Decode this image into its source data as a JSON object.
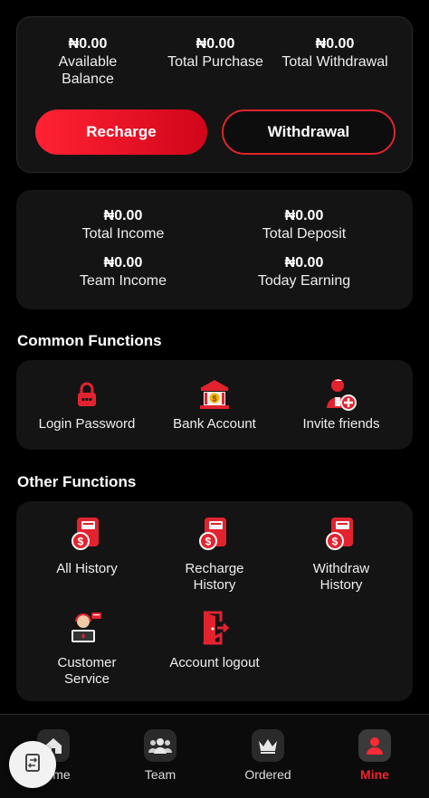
{
  "balance": {
    "stats": [
      {
        "amount": "₦0.00",
        "label": "Available Balance"
      },
      {
        "amount": "₦0.00",
        "label": "Total Purchase"
      },
      {
        "amount": "₦0.00",
        "label": "Total Withdrawal"
      }
    ],
    "recharge_label": "Recharge",
    "withdrawal_label": "Withdrawal"
  },
  "income": {
    "stats": [
      {
        "amount": "₦0.00",
        "label": "Total Income"
      },
      {
        "amount": "₦0.00",
        "label": "Total Deposit"
      },
      {
        "amount": "₦0.00",
        "label": "Team Income"
      },
      {
        "amount": "₦0.00",
        "label": "Today Earning"
      }
    ]
  },
  "common_functions": {
    "title": "Common Functions",
    "items": [
      {
        "label": "Login Password",
        "icon": "lock-icon"
      },
      {
        "label": "Bank Account",
        "icon": "bank-icon"
      },
      {
        "label": "Invite friends",
        "icon": "add-user-icon"
      }
    ]
  },
  "other_functions": {
    "title": "Other Functions",
    "items": [
      {
        "label": "All History",
        "icon": "dollar-document-icon"
      },
      {
        "label": "Recharge History",
        "icon": "dollar-document-icon"
      },
      {
        "label": "Withdraw History",
        "icon": "dollar-document-icon"
      },
      {
        "label": "Customer Service",
        "icon": "support-agent-icon"
      },
      {
        "label": "Account logout",
        "icon": "logout-door-icon"
      }
    ]
  },
  "nav": {
    "items": [
      {
        "label": "Home",
        "icon": "home-icon"
      },
      {
        "label": "Team",
        "icon": "team-icon"
      },
      {
        "label": "Ordered",
        "icon": "crown-icon"
      },
      {
        "label": "Mine",
        "icon": "user-icon"
      }
    ],
    "active": "Mine"
  },
  "colors": {
    "accent": "#e2232f",
    "background": "#000000",
    "card": "#141414"
  }
}
